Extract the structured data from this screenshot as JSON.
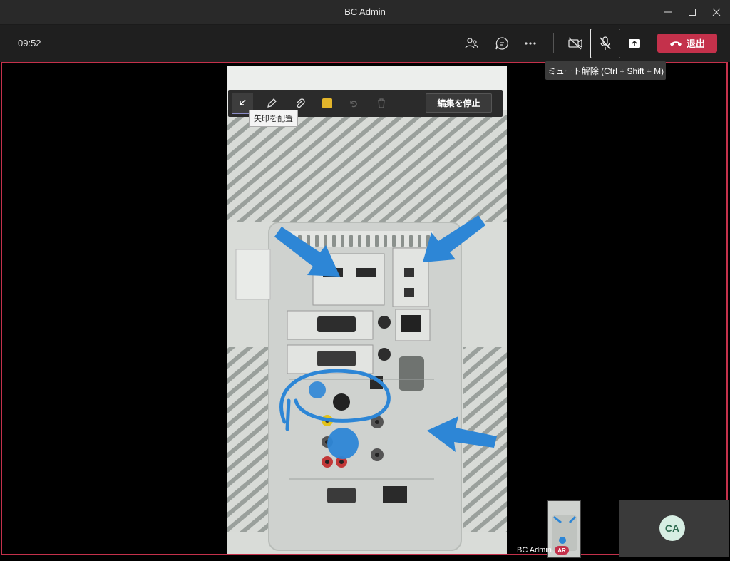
{
  "window": {
    "title": "BC Admin"
  },
  "toolbar": {
    "time": "09:52",
    "leave_label": "退出",
    "mute_tooltip": "ミュート解除 (Ctrl + Shift + M)"
  },
  "annotation": {
    "stop_edit_label": "編集を停止",
    "place_arrow_tooltip": "矢印を配置",
    "color": "#e3b52b"
  },
  "participants": {
    "self_name": "BC Admin",
    "self_badge": "AR",
    "remote_initials": "CA"
  },
  "colors": {
    "accent_red": "#c4314b",
    "arrow_blue": "#2d86d6"
  }
}
